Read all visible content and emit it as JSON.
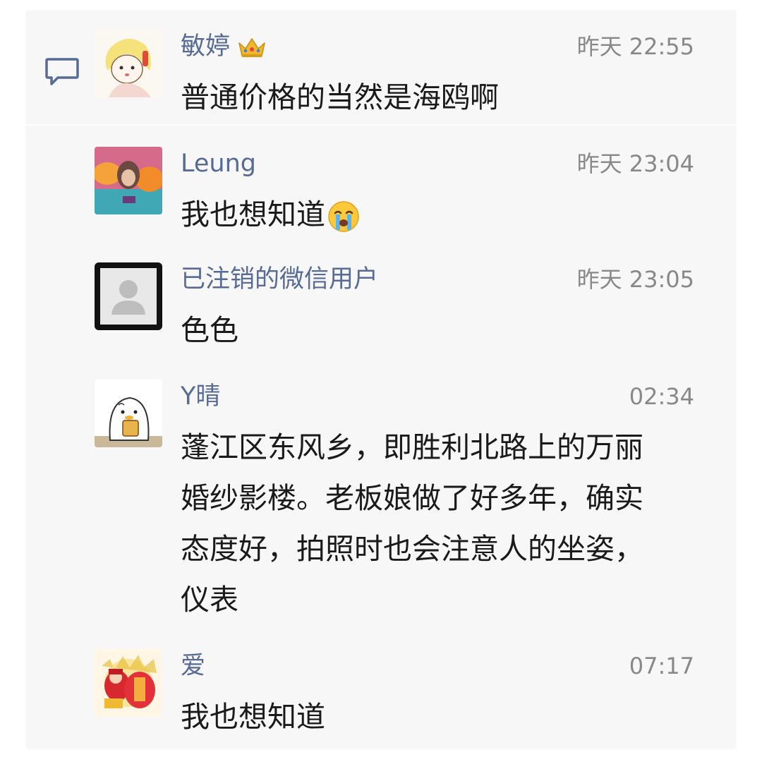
{
  "comments": [
    {
      "name": "敏婷",
      "badge": "crown-icon",
      "time": "昨天 22:55",
      "text": "普通价格的当然是海鸥啊"
    },
    {
      "name": "Leung",
      "time": "昨天 23:04",
      "text": "我也想知道",
      "emoji": "loudly-crying-face-emoji"
    },
    {
      "name": "已注销的微信用户",
      "time": "昨天 23:05",
      "text": "色色"
    },
    {
      "name": "Y晴",
      "time": "02:34",
      "text": "蓬江区东风乡，即胜利北路上的万丽\n婚纱影楼。老板娘做了好多年，确实\n态度好，拍照时也会注意人的坐姿，\n仪表"
    },
    {
      "name": "爱",
      "time": "07:17",
      "text": "我也想知道"
    }
  ],
  "colors": {
    "name": "#576b95",
    "time": "#888888",
    "text": "#1a1a1a",
    "panel": "#f7f7f7"
  },
  "icons": {
    "comment_section": "comment-bubble-icon"
  }
}
